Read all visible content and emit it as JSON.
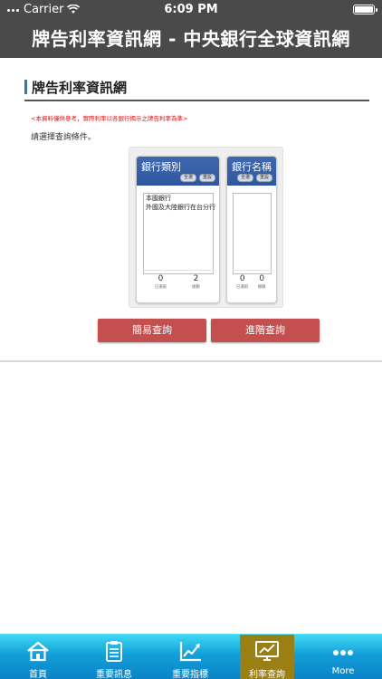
{
  "status": {
    "carrier": "Carrier",
    "time": "6:09 PM"
  },
  "app": {
    "title": "牌告利率資訊網 - 中央銀行全球資訊網"
  },
  "page": {
    "heading": "牌告利率資訊網",
    "disclaimer": "<本資料僅供參考，實際利率以各銀行揭示之牌告利率為準>",
    "prompt": "請選擇查詢條件。"
  },
  "bank_type_card": {
    "title": "銀行類別",
    "select_all": "全選",
    "reset": "重設",
    "options": [
      "本國銀行",
      "外國及大陸銀行在台分行"
    ],
    "selected_count": "0",
    "selected_caption": "已選取",
    "total_count": "2",
    "total_caption": "總數"
  },
  "bank_name_card": {
    "title": "銀行名稱",
    "select_all": "全選",
    "reset": "重設",
    "options": [],
    "selected_count": "0",
    "selected_caption": "已選取",
    "total_count": "0",
    "total_caption": "總數"
  },
  "actions": {
    "simple_query": "簡易查詢",
    "advanced_query": "進階查詢"
  },
  "tabbar": {
    "active_color": "#9a7f14",
    "tabs": [
      {
        "label": "首頁",
        "icon": "home-icon"
      },
      {
        "label": "重要訊息",
        "icon": "clipboard-icon"
      },
      {
        "label": "重要指標",
        "icon": "chart-icon"
      },
      {
        "label": "利率查詢",
        "icon": "monitor-chart-icon",
        "active": true
      },
      {
        "label": "More",
        "icon": "more-icon"
      }
    ]
  }
}
